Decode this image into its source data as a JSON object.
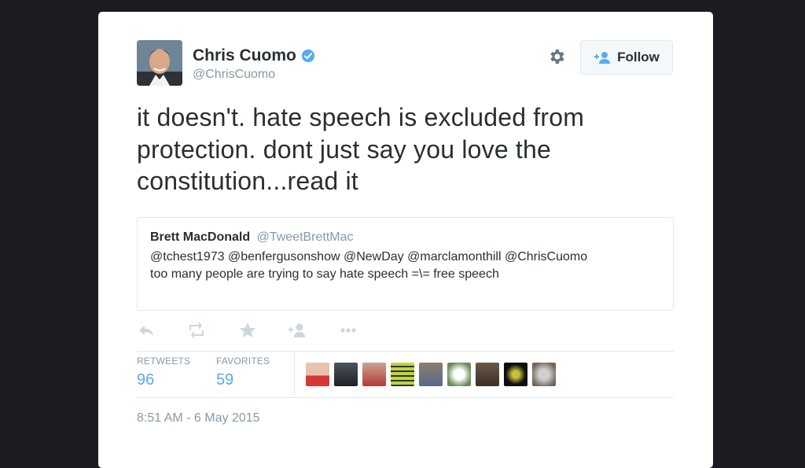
{
  "tweet": {
    "author_name": "Chris Cuomo",
    "author_handle": "@ChrisCuomo",
    "follow_label": "Follow",
    "text": "it doesn't. hate speech is excluded from protection. dont just say you love the constitution...read it",
    "quoted": {
      "author_name": "Brett MacDonald",
      "author_handle": "@TweetBrettMac",
      "text": "@tchest1973 @benfergusonshow @NewDay @marclamonthill @ChrisCuomo too many people are trying to say hate speech =\\= free speech"
    },
    "actions": [
      "reply-icon",
      "retweet-icon",
      "favorite-icon",
      "follow-user-icon",
      "more-icon"
    ],
    "stats": {
      "retweets_label": "RETWEETS",
      "retweets_value": "96",
      "favorites_label": "FAVORITES",
      "favorites_value": "59"
    },
    "favoriter_avatar_count": 9,
    "timestamp": "8:51 AM - 6 May 2015"
  },
  "colors": {
    "background": "#1c1d22",
    "card": "#ffffff",
    "accent": "#55acee",
    "text": "#292f33",
    "muted": "#8899a6",
    "border": "#e1e8ed"
  }
}
